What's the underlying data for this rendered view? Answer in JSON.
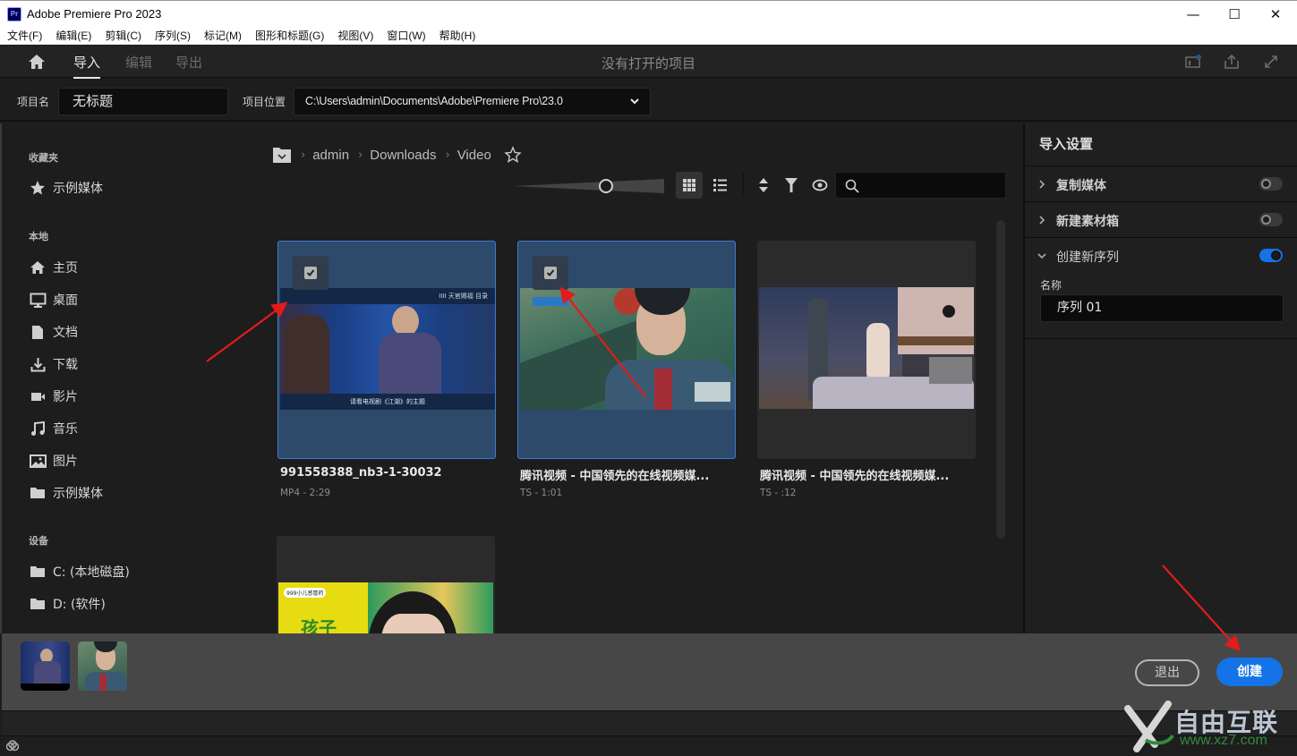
{
  "window": {
    "app_icon_text": "Pr",
    "title": "Adobe Premiere Pro 2023",
    "minimize": "—",
    "maximize": "☐",
    "close": "✕"
  },
  "menu": [
    "文件(F)",
    "编辑(E)",
    "剪辑(C)",
    "序列(S)",
    "标记(M)",
    "图形和标题(G)",
    "视图(V)",
    "窗口(W)",
    "帮助(H)"
  ],
  "header": {
    "tabs": [
      {
        "label": "导入",
        "active": true
      },
      {
        "label": "编辑",
        "active": false
      },
      {
        "label": "导出",
        "active": false
      }
    ],
    "title": "没有打开的项目"
  },
  "project": {
    "name_label": "项目名",
    "name_value": "无标题",
    "location_label": "项目位置",
    "location_value": "C:\\Users\\admin\\Documents\\Adobe\\Premiere Pro\\23.0"
  },
  "sidebar": {
    "favorites_header": "收藏夹",
    "favorites": [
      {
        "label": "示例媒体",
        "icon": "star-icon"
      }
    ],
    "local_header": "本地",
    "local": [
      {
        "label": "主页",
        "icon": "home-icon"
      },
      {
        "label": "桌面",
        "icon": "desktop-icon"
      },
      {
        "label": "文档",
        "icon": "document-icon"
      },
      {
        "label": "下载",
        "icon": "download-icon"
      },
      {
        "label": "影片",
        "icon": "video-camera-icon"
      },
      {
        "label": "音乐",
        "icon": "music-note-icon"
      },
      {
        "label": "图片",
        "icon": "picture-icon"
      },
      {
        "label": "示例媒体",
        "icon": "folder-icon"
      }
    ],
    "devices_header": "设备",
    "devices": [
      {
        "label": "C: (本地磁盘)",
        "icon": "folder-icon"
      },
      {
        "label": "D: (软件)",
        "icon": "folder-icon"
      }
    ]
  },
  "browser": {
    "breadcrumb": [
      "admin",
      "Downloads",
      "Video"
    ],
    "search_placeholder": "",
    "thumbnail_zoom_level": 0.62,
    "view_mode": "grid",
    "items": [
      {
        "title": "991558388_nb3-1-30032",
        "meta": "MP4 - 2:29",
        "selected": true
      },
      {
        "title": "腾讯视频 - 中国领先的在线视频媒...",
        "meta": "TS - 1:01",
        "selected": true
      },
      {
        "title": "腾讯视频 - 中国领先的在线视频媒...",
        "meta": "TS - :12",
        "selected": false
      },
      {
        "title": "",
        "meta": "",
        "selected": false
      }
    ],
    "thumb_texts": {
      "item1_top": "IIII 天官赐福 目录",
      "item1_caption": "请看电视剧《江湖》的主题",
      "item4_logo": "999小儿感冒药",
      "item4_text": "孩子"
    }
  },
  "import_settings": {
    "title": "导入设置",
    "rows": [
      {
        "label": "复制媒体",
        "expanded": false,
        "enabled": false
      },
      {
        "label": "新建素材箱",
        "expanded": false,
        "enabled": false
      },
      {
        "label": "创建新序列",
        "expanded": true,
        "enabled": true
      }
    ],
    "name_label": "名称",
    "sequence_name": "序列 01"
  },
  "footer": {
    "selected_count": 2,
    "exit_label": "退出",
    "create_label": "创建"
  },
  "watermark": {
    "text": "自由互联",
    "url": "www.xz7.com"
  },
  "colors": {
    "accent": "#1473e6",
    "selected_card": "#2d4a6a",
    "annotation_arrow": "#e31b1b"
  }
}
